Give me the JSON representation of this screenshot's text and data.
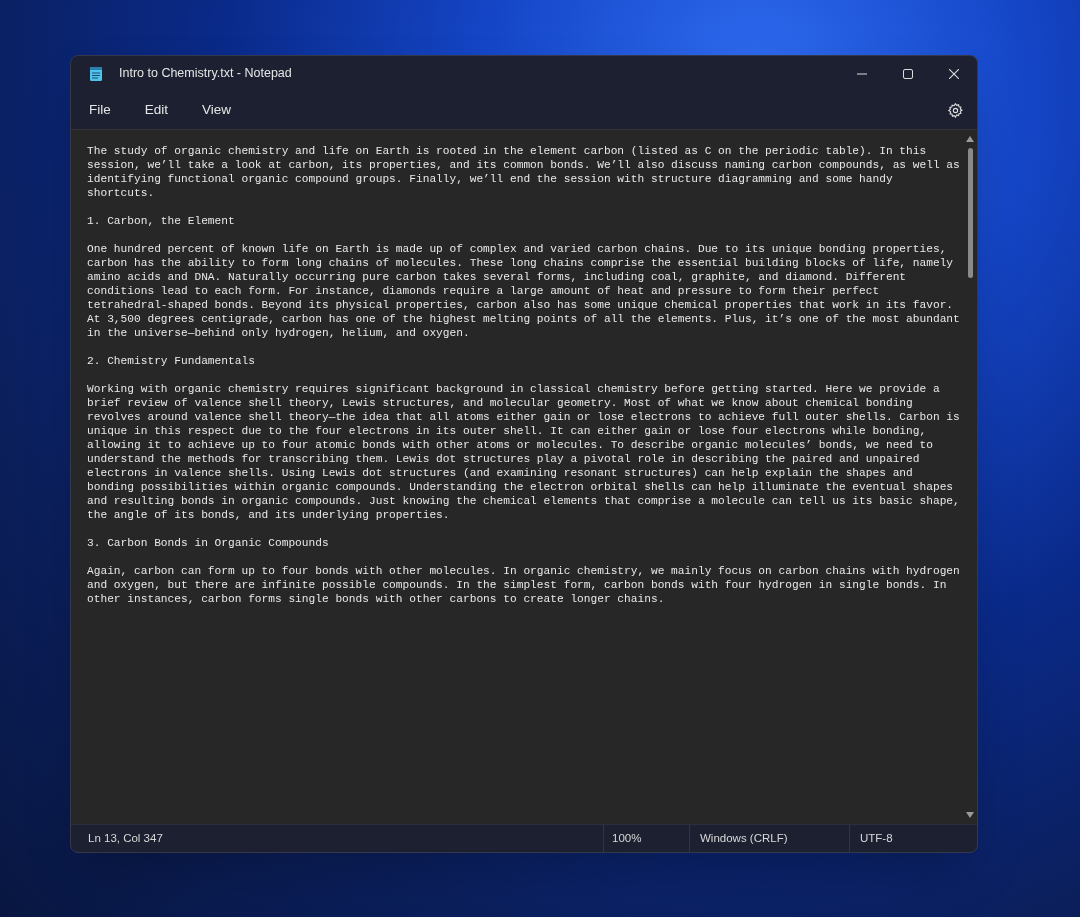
{
  "window": {
    "title": "Intro to Chemistry.txt - Notepad"
  },
  "menu": [
    "File",
    "Edit",
    "View"
  ],
  "document": {
    "paragraphs": [
      "The study of organic chemistry and life on Earth is rooted in the element carbon (listed as C on the periodic table). In this session, we’ll take a look at carbon, its properties, and its common bonds. We’ll also discuss naming carbon compounds, as well as identifying functional organic compound groups. Finally, we’ll end the session with structure diagramming and some handy shortcuts.",
      "1. Carbon, the Element",
      "One hundred percent of known life on Earth is made up of complex and varied carbon chains. Due to its unique bonding properties, carbon has the ability to form long chains of molecules. These long chains comprise the essential building blocks of life, namely amino acids and DNA. Naturally occurring pure carbon takes several forms, including coal, graphite, and diamond. Different conditions lead to each form. For instance, diamonds require a large amount of heat and pressure to form their perfect tetrahedral-shaped bonds. Beyond its physical properties, carbon also has some unique chemical properties that work in its favor. At 3,500 degrees centigrade, carbon has one of the highest melting points of all the elements. Plus, it’s one of the most abundant in the universe—behind only hydrogen, helium, and oxygen.",
      "2. Chemistry Fundamentals",
      "Working with organic chemistry requires significant background in classical chemistry before getting started. Here we provide a brief review of valence shell theory, Lewis structures, and molecular geometry. Most of what we know about chemical bonding revolves around valence shell theory—the idea that all atoms either gain or lose electrons to achieve full outer shells. Carbon is unique in this respect due to the four electrons in its outer shell. It can either gain or lose four electrons while bonding, allowing it to achieve up to four atomic bonds with other atoms or molecules. To describe organic molecules’ bonds, we need to understand the methods for transcribing them. Lewis dot structures play a pivotal role in describing the paired and unpaired electrons in valence shells. Using Lewis dot structures (and examining resonant structures) can help explain the shapes and bonding possibilities within organic compounds. Understanding the electron orbital shells can help illuminate the eventual shapes and resulting bonds in organic compounds. Just knowing the chemical elements that comprise a molecule can tell us its basic shape, the angle of its bonds, and its underlying properties.",
      "3. Carbon Bonds in Organic Compounds",
      "Again, carbon can form up to four bonds with other molecules. In organic chemistry, we mainly focus on carbon chains with hydrogen and oxygen, but there are infinite possible compounds. In the simplest form, carbon bonds with four hydrogen in single bonds. In other instances, carbon forms single bonds with other carbons to create longer chains."
    ]
  },
  "status_bar": {
    "position": "Ln 13, Col 347",
    "zoom": "100%",
    "line_ending": "Windows (CRLF)",
    "encoding": "UTF-8"
  }
}
